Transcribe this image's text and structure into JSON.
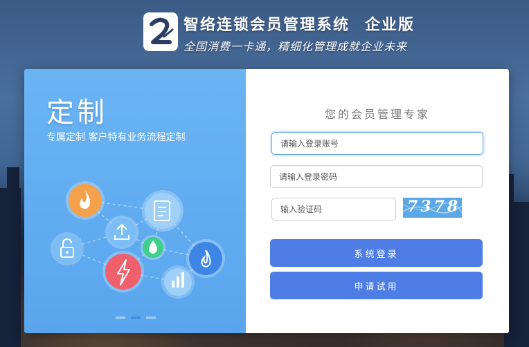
{
  "header": {
    "title": "智络连锁会员管理系统",
    "edition": "企业版",
    "slogan": "全国消费一卡通，精细化管理成就企业未来",
    "logo_icon": "brand-logo-icon"
  },
  "promo": {
    "title": "定制",
    "subtitle": "专属定制 客户特有业务流程定制",
    "icons": [
      "fire-icon",
      "upload-icon",
      "document-icon",
      "unlock-icon",
      "water-drop-icon",
      "lightning-icon",
      "flame-icon",
      "bar-chart-icon"
    ],
    "carousel": {
      "count": 3,
      "active": 2
    }
  },
  "login": {
    "heading": "您的会员管理专家",
    "account_placeholder": "请输入登录账号",
    "password_placeholder": "请输入登录密码",
    "captcha_placeholder": "输入验证码",
    "captcha_code": "7378",
    "login_button": "系统登录",
    "trial_button": "申请试用"
  },
  "colors": {
    "accent": "#4e7de6",
    "promo_bg": "#5aa6ee",
    "orange": "#f5a04a",
    "red": "#f0606c",
    "green": "#3fcf8a",
    "blue": "#3d86e6"
  }
}
